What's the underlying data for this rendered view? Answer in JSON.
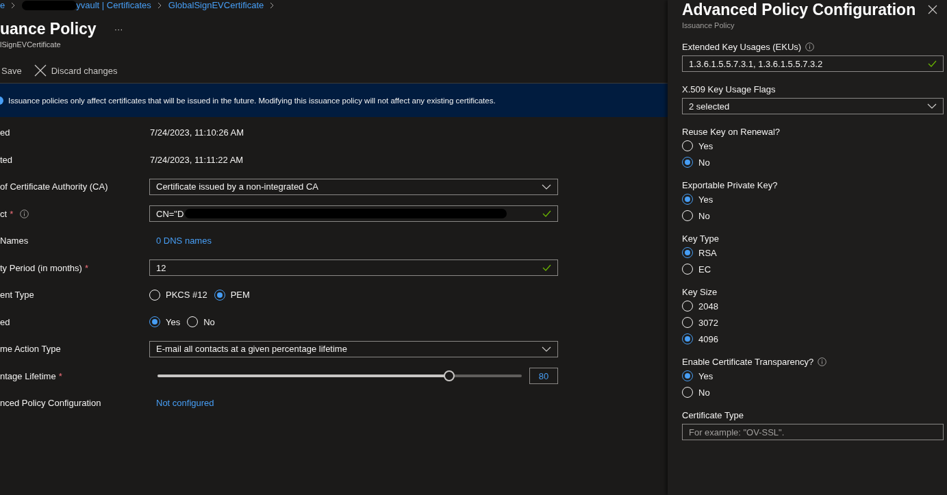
{
  "breadcrumb": [
    {
      "kind": "link",
      "text": "e"
    },
    {
      "kind": "redaction"
    },
    {
      "kind": "link",
      "text": "yvault | Certificates"
    },
    {
      "kind": "link",
      "text": "GlobalSignEVCertificate"
    }
  ],
  "page": {
    "title": "uance Policy",
    "more": "···",
    "subtitle": "lSignEVCertificate"
  },
  "toolbar": [
    {
      "kind": "save",
      "label": "Save"
    },
    {
      "kind": "discard",
      "label": "Discard changes"
    }
  ],
  "banner": {
    "text": "Issuance policies only affect certificates that will be issued in the future. Modifying this issuance policy will not affect any existing certificates."
  },
  "form": [
    {
      "kind": "text",
      "label": "ed",
      "value": "7/24/2023, 11:10:26 AM"
    },
    {
      "kind": "text",
      "label": "ted",
      "value": "7/24/2023, 11:11:22 AM"
    },
    {
      "kind": "dropdown",
      "label": "of Certificate Authority (CA)",
      "value": "Certificate issued by a non-integrated CA"
    },
    {
      "kind": "input",
      "label": "ct",
      "required_mark": "*",
      "info": true,
      "value": "CN=\"D",
      "redacted": true,
      "valid": true
    },
    {
      "kind": "link",
      "label": "Names",
      "value": "0 DNS names"
    },
    {
      "kind": "input",
      "label": "ty Period (in months)",
      "required_mark": "*",
      "value": "12",
      "valid": true
    },
    {
      "kind": "radio",
      "label": "ent Type",
      "options": [
        {
          "label": "PKCS #12",
          "selected": false
        },
        {
          "label": "PEM",
          "selected": true
        }
      ]
    },
    {
      "kind": "radio",
      "label": "ed",
      "options": [
        {
          "label": "Yes",
          "selected": true
        },
        {
          "label": "No",
          "selected": false
        }
      ]
    },
    {
      "kind": "dropdown",
      "label": "me Action Type",
      "value": "E-mail all contacts at a given percentage lifetime"
    },
    {
      "kind": "slider",
      "label": "ntage Lifetime",
      "required_mark": "*",
      "level": 0.8,
      "value": "80"
    },
    {
      "kind": "link",
      "label": "nced Policy Configuration",
      "value": "Not configured"
    }
  ],
  "panel": {
    "title": "Advanced Policy Configuration",
    "subtitle": "Issuance Policy",
    "fields": [
      {
        "kind": "input",
        "label": "Extended Key Usages (EKUs)",
        "info": true,
        "value": "1.3.6.1.5.5.7.3.1, 1.3.6.1.5.5.7.3.2",
        "valid": true
      },
      {
        "kind": "dropdown",
        "label": "X.509 Key Usage Flags",
        "value": "2 selected"
      },
      {
        "kind": "radio",
        "label": "Reuse Key on Renewal?",
        "options": [
          {
            "label": "Yes",
            "selected": false
          },
          {
            "label": "No",
            "selected": true
          }
        ]
      },
      {
        "kind": "radio",
        "label": "Exportable Private Key?",
        "options": [
          {
            "label": "Yes",
            "selected": true
          },
          {
            "label": "No",
            "selected": false
          }
        ]
      },
      {
        "kind": "radio",
        "label": "Key Type",
        "options": [
          {
            "label": "RSA",
            "selected": true
          },
          {
            "label": "EC",
            "selected": false
          }
        ]
      },
      {
        "kind": "radio",
        "label": "Key Size",
        "options": [
          {
            "label": "2048",
            "selected": false
          },
          {
            "label": "3072",
            "selected": false
          },
          {
            "label": "4096",
            "selected": true
          }
        ]
      },
      {
        "kind": "radio",
        "label": "Enable Certificate Transparency?",
        "info": true,
        "options": [
          {
            "label": "Yes",
            "selected": true
          },
          {
            "label": "No",
            "selected": false
          }
        ]
      },
      {
        "kind": "input",
        "label": "Certificate Type",
        "placeholder": "For example: \"OV-SSL\"."
      }
    ]
  }
}
